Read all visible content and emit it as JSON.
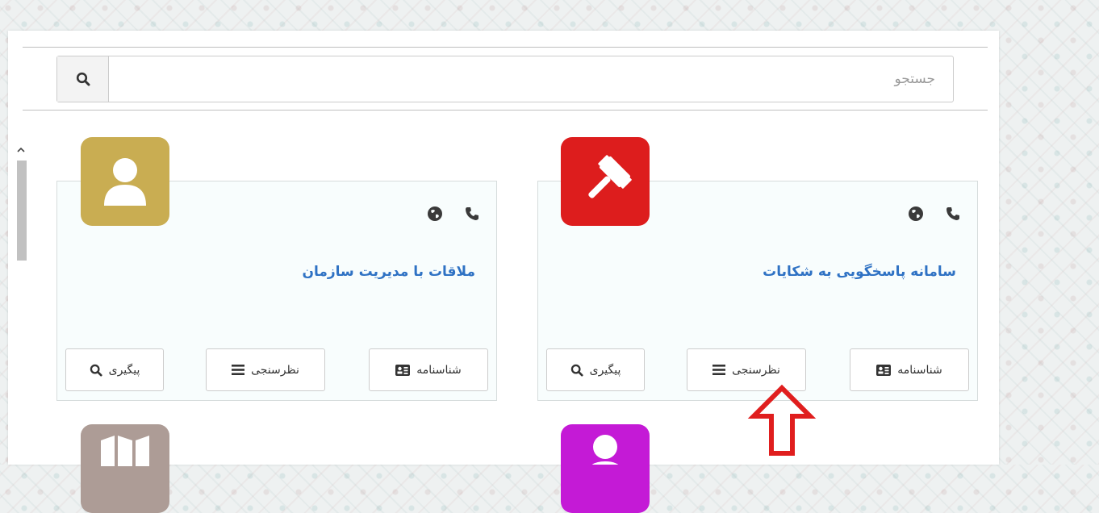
{
  "search": {
    "placeholder": "جستجو",
    "button_icon": "search-icon"
  },
  "cards": [
    {
      "title": "سامانه پاسخگویی به شکایات",
      "icon": "gavel-icon",
      "icon_color": "#dd1d1d",
      "buttons": {
        "profile": "شناسنامه",
        "survey": "نظرسنجی",
        "track": "پیگیری"
      }
    },
    {
      "title": "ملاقات با مدیریت سازمان",
      "icon": "user-icon",
      "icon_color": "#c9ad52",
      "buttons": {
        "profile": "شناسنامه",
        "survey": "نظرسنجی",
        "track": "پیگیری"
      }
    }
  ],
  "partial_icons": [
    {
      "icon": "map-icon",
      "color": "#ad9c96"
    },
    {
      "icon": "user-icon",
      "color": "#c41ad6"
    }
  ],
  "annotation": {
    "icon": "arrow-up-icon",
    "color": "#e01e1e"
  },
  "colors": {
    "link": "#2f72c4",
    "card_bg": "#f8fdfd"
  }
}
